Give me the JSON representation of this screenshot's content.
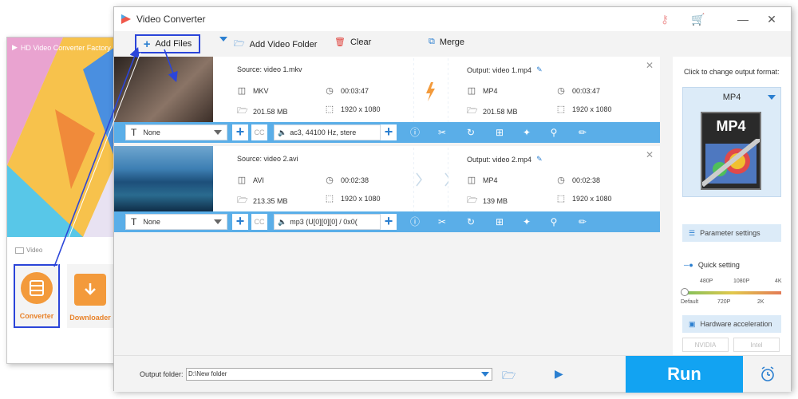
{
  "launcher": {
    "title": "HD Video Converter Factory",
    "section_label": "Video",
    "tiles": [
      {
        "label": "Converter"
      },
      {
        "label": "Downloader"
      }
    ]
  },
  "window": {
    "title": "Video Converter"
  },
  "toolbar": {
    "add_files": "Add Files",
    "add_video_folder": "Add Video Folder",
    "clear": "Clear",
    "merge": "Merge"
  },
  "files": [
    {
      "source": "Source: video 1.mkv",
      "src_format": "MKV",
      "src_duration": "00:03:47",
      "src_size": "201.58 MB",
      "src_resolution": "1920 x 1080",
      "output": "Output: video 1.mp4",
      "out_format": "MP4",
      "out_duration": "00:03:47",
      "out_size": "201.58 MB",
      "out_resolution": "1920 x 1080",
      "subtitle": "None",
      "audio": "ac3, 44100 Hz, stere",
      "thumb_colors": [
        "#3a2f2a",
        "#8a7466"
      ]
    },
    {
      "source": "Source: video 2.avi",
      "src_format": "AVI",
      "src_duration": "00:02:38",
      "src_size": "213.35 MB",
      "src_resolution": "1920 x 1080",
      "output": "Output: video 2.mp4",
      "out_format": "MP4",
      "out_duration": "00:02:38",
      "out_size": "139 MB",
      "out_resolution": "1920 x 1080",
      "subtitle": "None",
      "audio": "mp3 (U[0][0][0] / 0x0(",
      "thumb_colors": [
        "#1d4f7a",
        "#5b9dc7"
      ]
    }
  ],
  "right_panel": {
    "hint": "Click to change output format:",
    "format": "MP4",
    "format_icon_text": "MP4",
    "parameter_settings": "Parameter settings",
    "quick_setting": "Quick setting",
    "ticks_top": [
      "480P",
      "1080P",
      "4K"
    ],
    "ticks_bottom": [
      "Default",
      "720P",
      "2K"
    ],
    "hardware_acceleration": "Hardware acceleration",
    "gpu_nvidia": "NVIDIA",
    "gpu_intel": "Intel"
  },
  "bottom": {
    "output_label": "Output folder:",
    "output_path": "D:\\New folder",
    "run": "Run"
  },
  "colors": {
    "accent": "#12a3f2",
    "bar": "#5aaee8",
    "highlight": "#2b45d9",
    "orange": "#f39a3b"
  }
}
